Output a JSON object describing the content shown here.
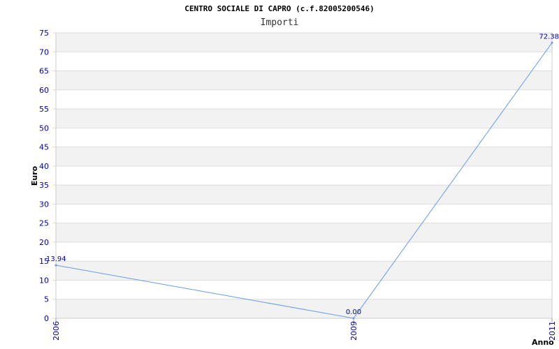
{
  "chart_data": {
    "type": "line",
    "title": "CENTRO SOCIALE DI CAPRO (c.f.82005200546)",
    "subtitle": "Importi",
    "xlabel": "Anno",
    "ylabel": "Euro",
    "categories": [
      "2006",
      "2009",
      "2011"
    ],
    "x": [
      2006,
      2009,
      2011
    ],
    "series": [
      {
        "values": [
          13.94,
          0.0,
          72.38
        ],
        "labels": [
          "13.94",
          "0.00",
          "72.38"
        ]
      }
    ],
    "ylim": [
      0,
      75
    ],
    "yticks": [
      0,
      5,
      10,
      15,
      20,
      25,
      30,
      35,
      40,
      45,
      50,
      55,
      60,
      65,
      70,
      75
    ],
    "grid": true,
    "colors": {
      "line": "#6699ee",
      "band": "#f2f2f2",
      "tick": "#0000aa",
      "grid": "#dddddd"
    }
  }
}
